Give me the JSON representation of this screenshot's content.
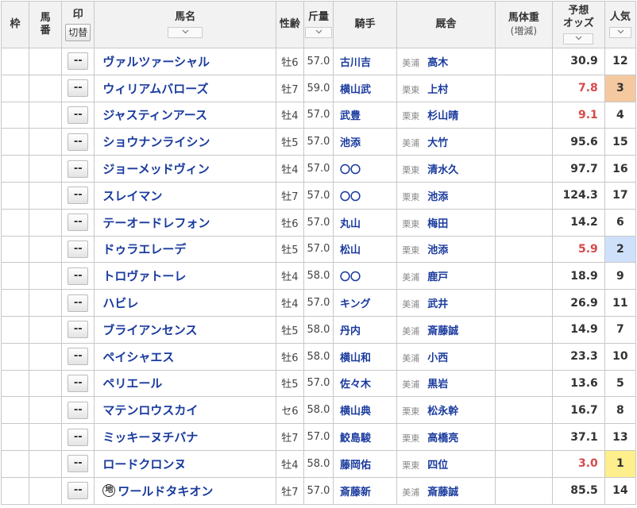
{
  "headers": {
    "waku": "枠",
    "umaban": "馬\n番",
    "mark": "印",
    "mark_toggle": "切替",
    "name": "馬名",
    "sex_age": "性齢",
    "weight": "斤量",
    "jockey": "騎手",
    "stable": "厩舎",
    "body_weight": "馬体重",
    "body_weight_sub": "(増減)",
    "odds": "予想\nオッズ",
    "popularity": "人気"
  },
  "rows": [
    {
      "mark": "--",
      "name": "ヴァルツァーシャル",
      "local": "",
      "sex_age": "牡6",
      "weight": "57.0",
      "jockey": "古川吉",
      "area": "美浦",
      "trainer": "高木",
      "odds": "30.9",
      "pop": "12",
      "hot": false,
      "rank": ""
    },
    {
      "mark": "--",
      "name": "ウィリアムバローズ",
      "local": "",
      "sex_age": "牡7",
      "weight": "59.0",
      "jockey": "横山武",
      "area": "栗東",
      "trainer": "上村",
      "odds": "7.8",
      "pop": "3",
      "hot": true,
      "rank": "rank3"
    },
    {
      "mark": "--",
      "name": "ジャスティンアース",
      "local": "",
      "sex_age": "牡4",
      "weight": "57.0",
      "jockey": "武豊",
      "area": "栗東",
      "trainer": "杉山晴",
      "odds": "9.1",
      "pop": "4",
      "hot": true,
      "rank": ""
    },
    {
      "mark": "--",
      "name": "ショウナンライシン",
      "local": "",
      "sex_age": "牡5",
      "weight": "57.0",
      "jockey": "池添",
      "area": "美浦",
      "trainer": "大竹",
      "odds": "95.6",
      "pop": "15",
      "hot": false,
      "rank": ""
    },
    {
      "mark": "--",
      "name": "ジョーメッドヴィン",
      "local": "",
      "sex_age": "牡4",
      "weight": "57.0",
      "jockey": "〇〇",
      "area": "栗東",
      "trainer": "清水久",
      "odds": "97.7",
      "pop": "16",
      "hot": false,
      "rank": ""
    },
    {
      "mark": "--",
      "name": "スレイマン",
      "local": "",
      "sex_age": "牡7",
      "weight": "57.0",
      "jockey": "〇〇",
      "area": "栗東",
      "trainer": "池添",
      "odds": "124.3",
      "pop": "17",
      "hot": false,
      "rank": ""
    },
    {
      "mark": "--",
      "name": "テーオードレフォン",
      "local": "",
      "sex_age": "牡6",
      "weight": "57.0",
      "jockey": "丸山",
      "area": "栗東",
      "trainer": "梅田",
      "odds": "14.2",
      "pop": "6",
      "hot": false,
      "rank": ""
    },
    {
      "mark": "--",
      "name": "ドゥラエレーデ",
      "local": "",
      "sex_age": "牡5",
      "weight": "57.0",
      "jockey": "松山",
      "area": "栗東",
      "trainer": "池添",
      "odds": "5.9",
      "pop": "2",
      "hot": true,
      "rank": "rank2"
    },
    {
      "mark": "--",
      "name": "トロヴァトーレ",
      "local": "",
      "sex_age": "牡4",
      "weight": "58.0",
      "jockey": "〇〇",
      "area": "美浦",
      "trainer": "鹿戸",
      "odds": "18.9",
      "pop": "9",
      "hot": false,
      "rank": ""
    },
    {
      "mark": "--",
      "name": "ハビレ",
      "local": "",
      "sex_age": "牡4",
      "weight": "57.0",
      "jockey": "キング",
      "area": "美浦",
      "trainer": "武井",
      "odds": "26.9",
      "pop": "11",
      "hot": false,
      "rank": ""
    },
    {
      "mark": "--",
      "name": "ブライアンセンス",
      "local": "",
      "sex_age": "牡5",
      "weight": "58.0",
      "jockey": "丹内",
      "area": "美浦",
      "trainer": "斎藤誠",
      "odds": "14.9",
      "pop": "7",
      "hot": false,
      "rank": ""
    },
    {
      "mark": "--",
      "name": "ペイシャエス",
      "local": "",
      "sex_age": "牡6",
      "weight": "58.0",
      "jockey": "横山和",
      "area": "美浦",
      "trainer": "小西",
      "odds": "23.3",
      "pop": "10",
      "hot": false,
      "rank": ""
    },
    {
      "mark": "--",
      "name": "ペリエール",
      "local": "",
      "sex_age": "牡5",
      "weight": "57.0",
      "jockey": "佐々木",
      "area": "美浦",
      "trainer": "黒岩",
      "odds": "13.6",
      "pop": "5",
      "hot": false,
      "rank": ""
    },
    {
      "mark": "--",
      "name": "マテンロウスカイ",
      "local": "",
      "sex_age": "セ6",
      "weight": "58.0",
      "jockey": "横山典",
      "area": "栗東",
      "trainer": "松永幹",
      "odds": "16.7",
      "pop": "8",
      "hot": false,
      "rank": ""
    },
    {
      "mark": "--",
      "name": "ミッキーヌチバナ",
      "local": "",
      "sex_age": "牡7",
      "weight": "57.0",
      "jockey": "鮫島駿",
      "area": "栗東",
      "trainer": "高橋亮",
      "odds": "37.1",
      "pop": "13",
      "hot": false,
      "rank": ""
    },
    {
      "mark": "--",
      "name": "ロードクロンヌ",
      "local": "",
      "sex_age": "牡4",
      "weight": "58.0",
      "jockey": "藤岡佑",
      "area": "栗東",
      "trainer": "四位",
      "odds": "3.0",
      "pop": "1",
      "hot": true,
      "rank": "rank1"
    },
    {
      "mark": "--",
      "name": "ワールドタキオン",
      "local": "地",
      "sex_age": "牡7",
      "weight": "57.0",
      "jockey": "斎藤新",
      "area": "美浦",
      "trainer": "斎藤誠",
      "odds": "85.5",
      "pop": "14",
      "hot": false,
      "rank": ""
    }
  ]
}
